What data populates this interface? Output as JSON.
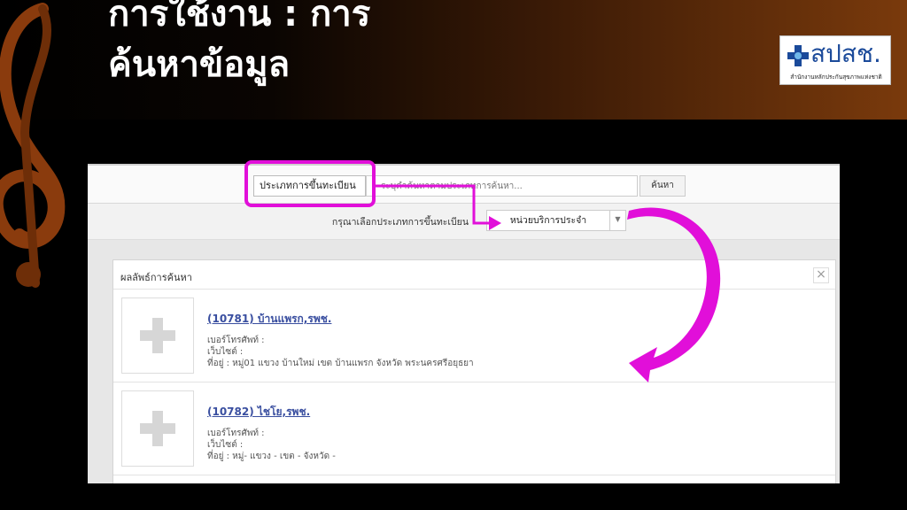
{
  "slide": {
    "title_line1": "การใช้งาน : การ",
    "title_line2": "ค้นหาข้อมูล"
  },
  "logo": {
    "text": "สปสช.",
    "subtitle": "สำนักงานหลักประกันสุขภาพแห่งชาติ"
  },
  "search": {
    "type_value": "ประเภทการขึ้นทะเบียน",
    "placeholder": "ระบุคำค้นหาตามประเภทการค้นหา...",
    "button_label": "ค้นหา"
  },
  "filter": {
    "label": "กรุณาเลือกประเภทการขึ้นทะเบียน",
    "selected": "หน่วยบริการประจำ"
  },
  "results": {
    "title": "ผลลัพธ์การค้นหา",
    "close_label": "×",
    "items": [
      {
        "name": "(10781) บ้านแพรก,รพช.",
        "phone": "เบอร์โทรศัพท์ :",
        "website": "เว็บไซต์ :",
        "address": "ที่อยู่ : หมู่01 แขวง บ้านใหม่ เขต บ้านแพรก จังหวัด พระนครศรีอยุธยา"
      },
      {
        "name": "(10782) ไชโย,รพช.",
        "phone": "เบอร์โทรศัพท์ :",
        "website": "เว็บไซต์ :",
        "address": "ที่อยู่ : หมู่- แขวง - เขต - จังหวัด -"
      }
    ]
  },
  "colors": {
    "highlight": "#e10fd9",
    "link": "#3a4fa0",
    "logo_blue": "#1b4a9a"
  },
  "icons": {
    "placeholder_thumb": "plus-icon",
    "close": "close-icon",
    "dropdown": "chevron-down-icon",
    "logo_mark": "medical-cross-icon"
  }
}
